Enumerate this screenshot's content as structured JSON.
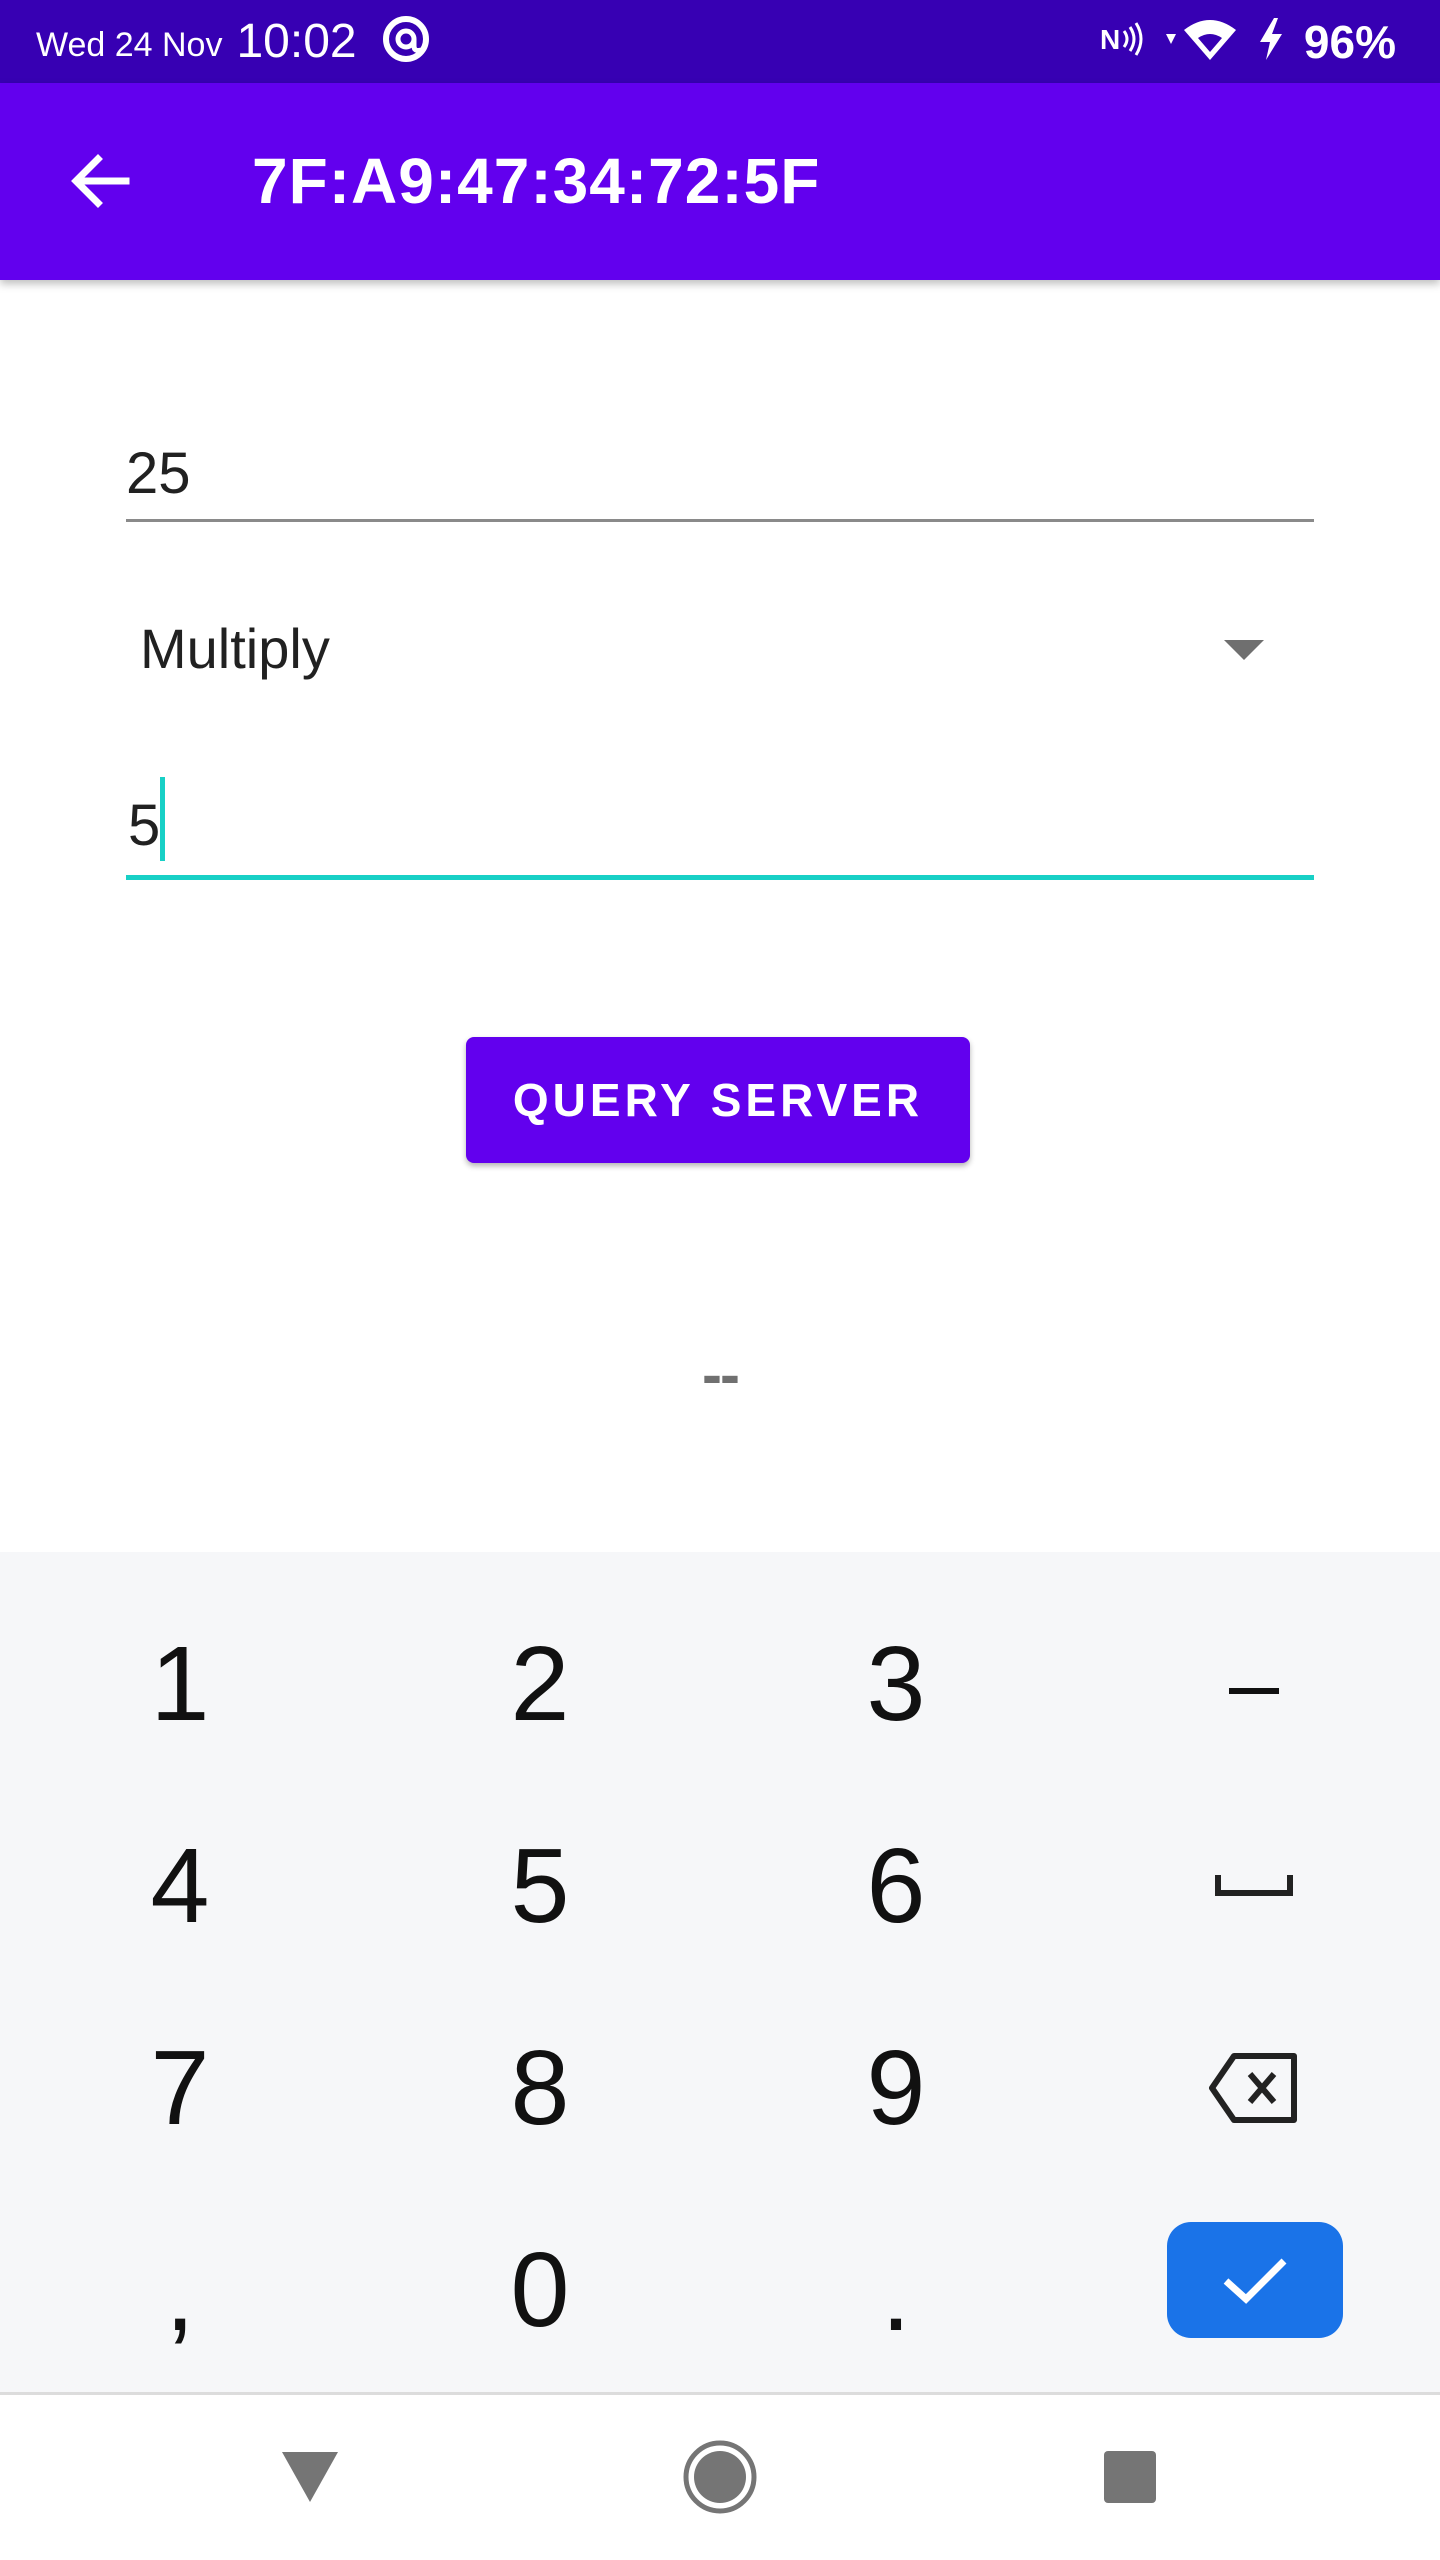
{
  "status_bar": {
    "date": "Wed 24 Nov",
    "time": "10:02",
    "battery": "96%",
    "icons": [
      "at-sign-icon",
      "nfc-icon",
      "wifi-icon",
      "charging-icon"
    ]
  },
  "app_bar": {
    "title": "7F:A9:47:34:72:5F",
    "back_icon": "arrow-back-icon"
  },
  "form": {
    "first_operand": "25",
    "operation": "Multiply",
    "second_operand": "5",
    "query_button": "QUERY SERVER",
    "result": "--"
  },
  "keyboard": {
    "rows": [
      [
        "1",
        "2",
        "3",
        "–"
      ],
      [
        "4",
        "5",
        "6",
        "space"
      ],
      [
        "7",
        "8",
        "9",
        "backspace"
      ],
      [
        ",",
        "0",
        ".",
        "enter"
      ]
    ]
  },
  "colors": {
    "status_bar": "#3700B3",
    "primary": "#6200EE",
    "accent": "#18D0C6",
    "keyboard_enter": "#1A73E8"
  }
}
